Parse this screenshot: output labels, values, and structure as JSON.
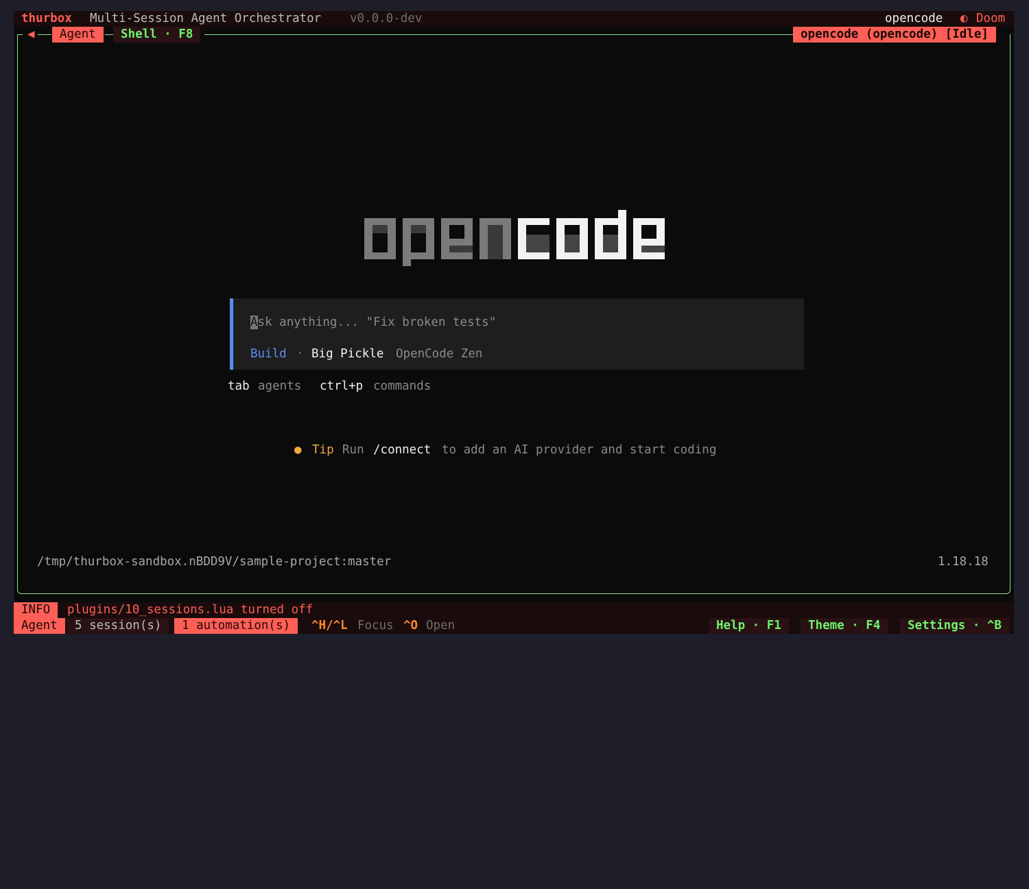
{
  "titlebar": {
    "app_name": "thurbox",
    "subtitle": "Multi-Session Agent Orchestrator",
    "version": "v0.0.0-dev",
    "agent_name": "opencode",
    "theme_icon": "half-circle-icon",
    "theme_glyph": "◐",
    "theme_name": "Doom"
  },
  "tabs": {
    "back_arrow": "◀",
    "agent_tab": "Agent",
    "shell_tab": "Shell · F8",
    "session_badge": "opencode (opencode) [Idle]"
  },
  "logo": {
    "text": "opencode"
  },
  "prompt": {
    "cursor_char": "A",
    "placeholder_rest": "sk anything... \"Fix broken tests\"",
    "mode": "Build",
    "separator": "·",
    "model": "Big Pickle",
    "provider": "OpenCode Zen"
  },
  "hints": {
    "key1": "tab",
    "desc1": "agents",
    "key2": "ctrl+p",
    "desc2": "commands"
  },
  "tip": {
    "bullet": "●",
    "label": "Tip",
    "text_before": "Run",
    "command": "/connect",
    "text_after": "to add an AI provider and start coding"
  },
  "footer": {
    "path": "/tmp/thurbox-sandbox.nBDD9V/sample-project:master",
    "app_version": "1.18.18"
  },
  "status_line1": {
    "level": "INFO",
    "message": "plugins/10_sessions.lua turned off"
  },
  "status_line2": {
    "mode": "Agent",
    "sessions": "5 session(s)",
    "automations": "1 automation(s)",
    "key_nav": "^H/^L",
    "nav_desc": "Focus",
    "key_open": "^O",
    "open_desc": "Open",
    "help": "Help · F1",
    "theme": "Theme · F4",
    "settings": "Settings · ^B"
  },
  "colors": {
    "accent_red": "#ff5f56",
    "accent_green": "#6ef26e",
    "border_green": "#8fe28f",
    "prompt_blue": "#5b8cf0",
    "tip_orange": "#f5a742",
    "background": "#0b0b0b"
  }
}
